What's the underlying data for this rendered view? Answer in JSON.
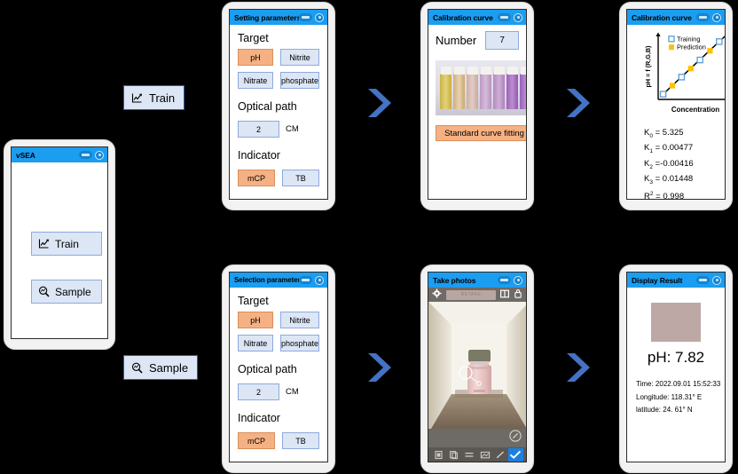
{
  "app": {
    "title": "vSEA"
  },
  "main_menu": {
    "buttons": [
      {
        "label": "Train",
        "icon": "line-chart-icon"
      },
      {
        "label": "Sample",
        "icon": "magnifier-icon"
      }
    ]
  },
  "flow_labels": {
    "train": {
      "label": "Train",
      "icon": "line-chart-icon"
    },
    "sample": {
      "label": "Sample",
      "icon": "magnifier-icon"
    }
  },
  "setting_panel": {
    "title": "Setting parameters",
    "target_label": "Target",
    "targets": [
      {
        "label": "pH",
        "selected": true
      },
      {
        "label": "Nitrite",
        "selected": false
      },
      {
        "label": "Nitrate",
        "selected": false
      },
      {
        "label": "phosphate",
        "selected": false
      }
    ],
    "optical_path_label": "Optical path",
    "optical_path_value": "2",
    "optical_path_unit": "CM",
    "indicator_label": "Indicator",
    "indicators": [
      {
        "label": "mCP",
        "selected": true
      },
      {
        "label": "TB",
        "selected": false
      }
    ]
  },
  "selection_panel": {
    "title": "Selection parameters",
    "target_label": "Target",
    "targets": [
      {
        "label": "pH",
        "selected": true
      },
      {
        "label": "Nitrite",
        "selected": false
      },
      {
        "label": "Nitrate",
        "selected": false
      },
      {
        "label": "phosphate",
        "selected": false
      }
    ],
    "optical_path_label": "Optical path",
    "optical_path_value": "2",
    "optical_path_unit": "CM",
    "indicator_label": "Indicator",
    "indicators": [
      {
        "label": "mCP",
        "selected": true
      },
      {
        "label": "TB",
        "selected": false
      }
    ]
  },
  "calibration_photo_panel": {
    "title": "Calibration curve",
    "number_label": "Number",
    "number_value": "7",
    "photo_name": "calibration-vials-photo",
    "vial_colors": [
      "#d9c457",
      "#dcbe8e",
      "#d9bcb4",
      "#c9a8cd",
      "#bf9ccc",
      "#a56fc0",
      "#9f69c5"
    ],
    "fit_button_label": "Standard curve fitting"
  },
  "chart_panel": {
    "title": "Calibration curve",
    "coefficients": [
      {
        "name": "K",
        "sub": "0",
        "text": "K0 = 5.325",
        "value": "5.325"
      },
      {
        "name": "K",
        "sub": "1",
        "text": "K1 = 0.00477",
        "value": "0.00477"
      },
      {
        "name": "K",
        "sub": "2",
        "text": "K2 =-0.00416",
        "value": "-0.00416"
      },
      {
        "name": "K",
        "sub": "3",
        "text": "K3 = 0.01448",
        "value": "0.01448"
      },
      {
        "name": "R",
        "sup": "2",
        "text": "R2 = 0.998",
        "value": "0.998"
      }
    ],
    "coef_lines": {
      "k0": "= 5.325",
      "k1": "= 0.00477",
      "k2": "=-0.00416",
      "k3": "= 0.01448",
      "r2": "= 0.998"
    }
  },
  "chart_data": {
    "type": "scatter",
    "title": "",
    "xlabel": "Concentration",
    "ylabel": "pH = f (R,G,B)",
    "xlim": [
      0,
      10
    ],
    "ylim": [
      0,
      10
    ],
    "grid": false,
    "legend_position": "top-left",
    "legend": [
      "Training",
      "Prediction"
    ],
    "series": [
      {
        "name": "Training",
        "marker": "open-square",
        "color": "#5b9bd5",
        "points": [
          [
            0.7,
            0.8
          ],
          [
            3.3,
            3.4
          ],
          [
            5.9,
            6.0
          ],
          [
            8.6,
            8.8
          ]
        ]
      },
      {
        "name": "Prediction",
        "marker": "filled-square",
        "color": "#ffc000",
        "points": [
          [
            2.0,
            2.1
          ],
          [
            4.6,
            4.7
          ],
          [
            7.3,
            7.4
          ]
        ]
      }
    ],
    "fit_line": {
      "from": [
        0.3,
        0.4
      ],
      "to": [
        9.4,
        9.6
      ],
      "color": "#000000"
    }
  },
  "camera_panel": {
    "title": "Take photos",
    "toolbar_chip_text": "RETAKE",
    "viewfinder_name": "camera-viewfinder-bottle",
    "bottom_icons": [
      "crop-icon",
      "copy-icon",
      "adjust-icon",
      "frame-icon",
      "pen-icon",
      "confirm-check-icon"
    ],
    "top_icons": [
      "gear-icon",
      "grid-icon",
      "lock-icon"
    ]
  },
  "result_panel": {
    "title": "Display Result",
    "swatch_name": "sample-color-swatch",
    "swatch_color": "#bda8a6",
    "ph_result": "pH: 7.82",
    "time": "Time: 2022.09.01 15:52:33",
    "longitude": "Longitude: 118.31° E",
    "latitude": "latitude: 24. 61° N"
  },
  "arrows": {
    "name": "flow-arrow-chevron",
    "color": "#4472c4"
  }
}
